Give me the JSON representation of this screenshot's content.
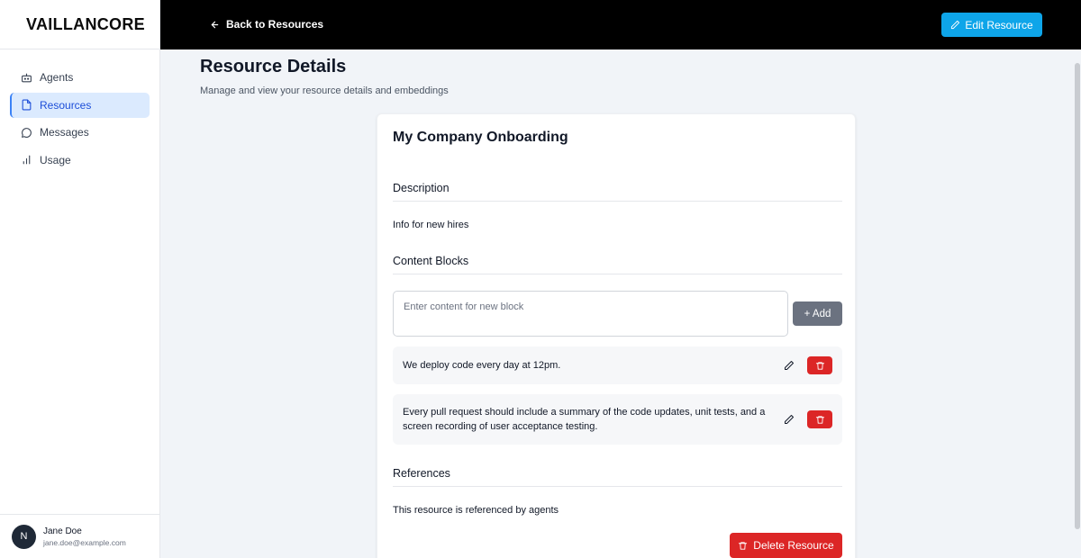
{
  "app": {
    "brand": "VAILLANCORE"
  },
  "sidebar": {
    "items": [
      {
        "label": "Agents",
        "icon": "bot-icon",
        "active": false
      },
      {
        "label": "Resources",
        "icon": "file-icon",
        "active": true
      },
      {
        "label": "Messages",
        "icon": "message-icon",
        "active": false
      },
      {
        "label": "Usage",
        "icon": "bar-chart-icon",
        "active": false
      }
    ],
    "user": {
      "initial": "N",
      "name": "Jane Doe",
      "email": "jane.doe@example.com"
    }
  },
  "topbar": {
    "back_label": "Back to Resources",
    "edit_label": "Edit Resource"
  },
  "page": {
    "title": "Resource Details",
    "subtitle": "Manage and view your resource details and embeddings"
  },
  "resource": {
    "name": "My Company Onboarding",
    "description_heading": "Description",
    "description": "Info for new hires",
    "content_heading": "Content Blocks",
    "new_block_placeholder": "Enter content for new block",
    "add_label": "+ Add",
    "blocks": [
      {
        "text": "We deploy code every day at 12pm."
      },
      {
        "text": "Every pull request should include a summary of the code updates, unit tests, and a screen recording of user acceptance testing."
      }
    ],
    "references_heading": "References",
    "references_text": "This resource is referenced by agents",
    "delete_label": "Delete Resource"
  },
  "colors": {
    "accent": "#0ea5e9",
    "danger": "#dc2626",
    "active_nav_bg": "#dbeafe",
    "topbar": "#000000"
  }
}
